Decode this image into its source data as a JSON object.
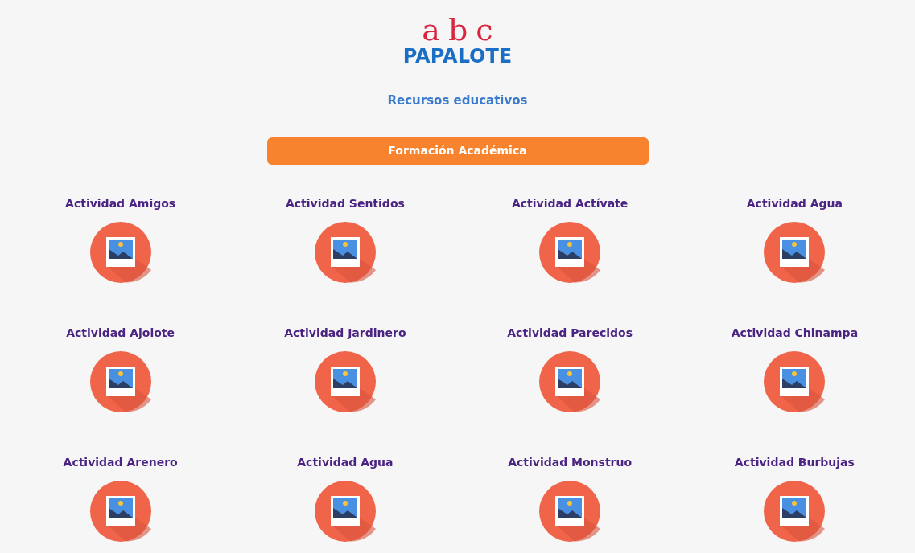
{
  "logo": {
    "letters": [
      "a",
      "b",
      "c"
    ],
    "wordmark": "PAPALOTE"
  },
  "subtitle": "Recursos educativos",
  "section_button": "Formación Académica",
  "activities": [
    {
      "title": "Actividad Amigos"
    },
    {
      "title": "Actividad Sentidos"
    },
    {
      "title": "Actividad Actívate"
    },
    {
      "title": "Actividad Agua"
    },
    {
      "title": "Actividad Ajolote"
    },
    {
      "title": "Actividad Jardinero"
    },
    {
      "title": "Actividad Parecidos"
    },
    {
      "title": "Actividad Chinampa"
    },
    {
      "title": "Actividad Arenero"
    },
    {
      "title": "Actividad Agua"
    },
    {
      "title": "Actividad Monstruo"
    },
    {
      "title": "Actividad Burbujas"
    }
  ]
}
